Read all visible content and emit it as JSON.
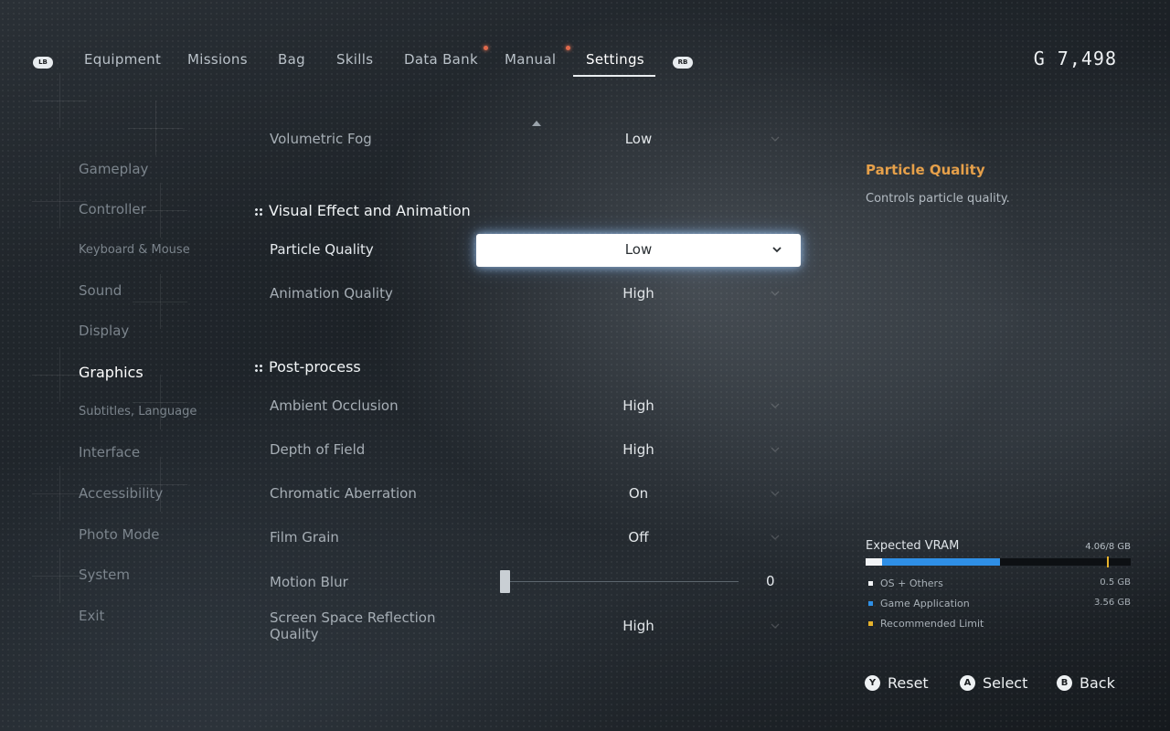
{
  "topbar": {
    "left_bumper": "LB",
    "right_bumper": "RB",
    "tabs": [
      {
        "label": "Equipment",
        "active": false,
        "notify": false
      },
      {
        "label": "Missions",
        "active": false,
        "notify": false
      },
      {
        "label": "Bag",
        "active": false,
        "notify": false
      },
      {
        "label": "Skills",
        "active": false,
        "notify": false
      },
      {
        "label": "Data Bank",
        "active": false,
        "notify": true
      },
      {
        "label": "Manual",
        "active": false,
        "notify": true
      },
      {
        "label": "Settings",
        "active": true,
        "notify": false
      }
    ],
    "currency_symbol": "G",
    "currency_amount": "7,498",
    "notify_color": "#e0694c"
  },
  "sidebar": {
    "items": [
      {
        "label": "Gameplay"
      },
      {
        "label": "Controller"
      },
      {
        "label": "Keyboard & Mouse"
      },
      {
        "label": "Sound"
      },
      {
        "label": "Display"
      },
      {
        "label": "Graphics"
      },
      {
        "label": "Subtitles, Language"
      },
      {
        "label": "Interface"
      },
      {
        "label": "Accessibility"
      },
      {
        "label": "Photo Mode"
      },
      {
        "label": "System"
      },
      {
        "label": "Exit"
      }
    ],
    "active": "Graphics"
  },
  "settings": {
    "volumetric_fog": {
      "label": "Volumetric Fog",
      "value": "Low"
    },
    "section_visual": "Visual Effect and Animation",
    "particle_quality": {
      "label": "Particle Quality",
      "value": "Low"
    },
    "animation_quality": {
      "label": "Animation Quality",
      "value": "High"
    },
    "section_post": "Post-process",
    "ambient_occlusion": {
      "label": "Ambient Occlusion",
      "value": "High"
    },
    "depth_of_field": {
      "label": "Depth of Field",
      "value": "High"
    },
    "chromatic_aberration": {
      "label": "Chromatic Aberration",
      "value": "On"
    },
    "film_grain": {
      "label": "Film Grain",
      "value": "Off"
    },
    "motion_blur": {
      "label": "Motion Blur",
      "value": "0",
      "level": 0
    },
    "ssr_quality": {
      "label": "Screen Space Reflection Quality",
      "value": "High"
    }
  },
  "description": {
    "title": "Particle Quality",
    "text": "Controls particle quality.",
    "title_color": "#e6a04a"
  },
  "vram": {
    "title": "Expected VRAM",
    "total": "4.06/8 GB",
    "used_gb": 4.06,
    "capacity_gb": 8,
    "limit_fraction": 0.91,
    "legend": [
      {
        "label": "OS + Others",
        "amount": "0.5 GB",
        "gb": 0.5,
        "color": "#f2f4f6"
      },
      {
        "label": "Game Application",
        "amount": "3.56 GB",
        "gb": 3.56,
        "color": "#2f8fe6"
      },
      {
        "label": "Recommended Limit",
        "amount": "",
        "gb": null,
        "color": "#e6b22c"
      }
    ]
  },
  "hints": [
    {
      "button": "Y",
      "label": "Reset"
    },
    {
      "button": "A",
      "label": "Select"
    },
    {
      "button": "B",
      "label": "Back"
    }
  ]
}
